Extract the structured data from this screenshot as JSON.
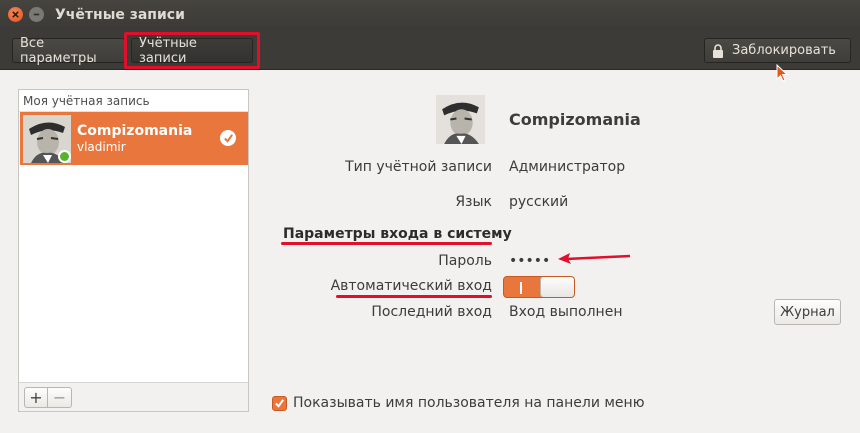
{
  "window": {
    "title": "Учётные записи"
  },
  "toolbar": {
    "all_settings": "Все параметры",
    "accounts": "Учётные записи",
    "lock": "Заблокировать"
  },
  "sidebar": {
    "header": "Моя учётная запись",
    "users": [
      {
        "name": "Compizomania",
        "login": "vladimir",
        "selected": true,
        "online": true
      }
    ],
    "add_label": "+",
    "remove_label": "−"
  },
  "details": {
    "name": "Compizomania",
    "account_type_label": "Тип учётной записи",
    "account_type_value": "Администратор",
    "language_label": "Язык",
    "language_value": "русский",
    "login_section": "Параметры входа в систему",
    "password_label": "Пароль",
    "password_value": "•••••",
    "autologin_label": "Автоматический вход",
    "autologin_on": true,
    "last_login_label": "Последний вход",
    "last_login_value": "Вход выполнен",
    "journal_button": "Журнал"
  },
  "show_username": {
    "label": "Показывать имя пользователя на панели меню",
    "checked": true
  },
  "colors": {
    "accent": "#e9773d",
    "highlight": "#e0102a",
    "online": "#58b22d"
  }
}
